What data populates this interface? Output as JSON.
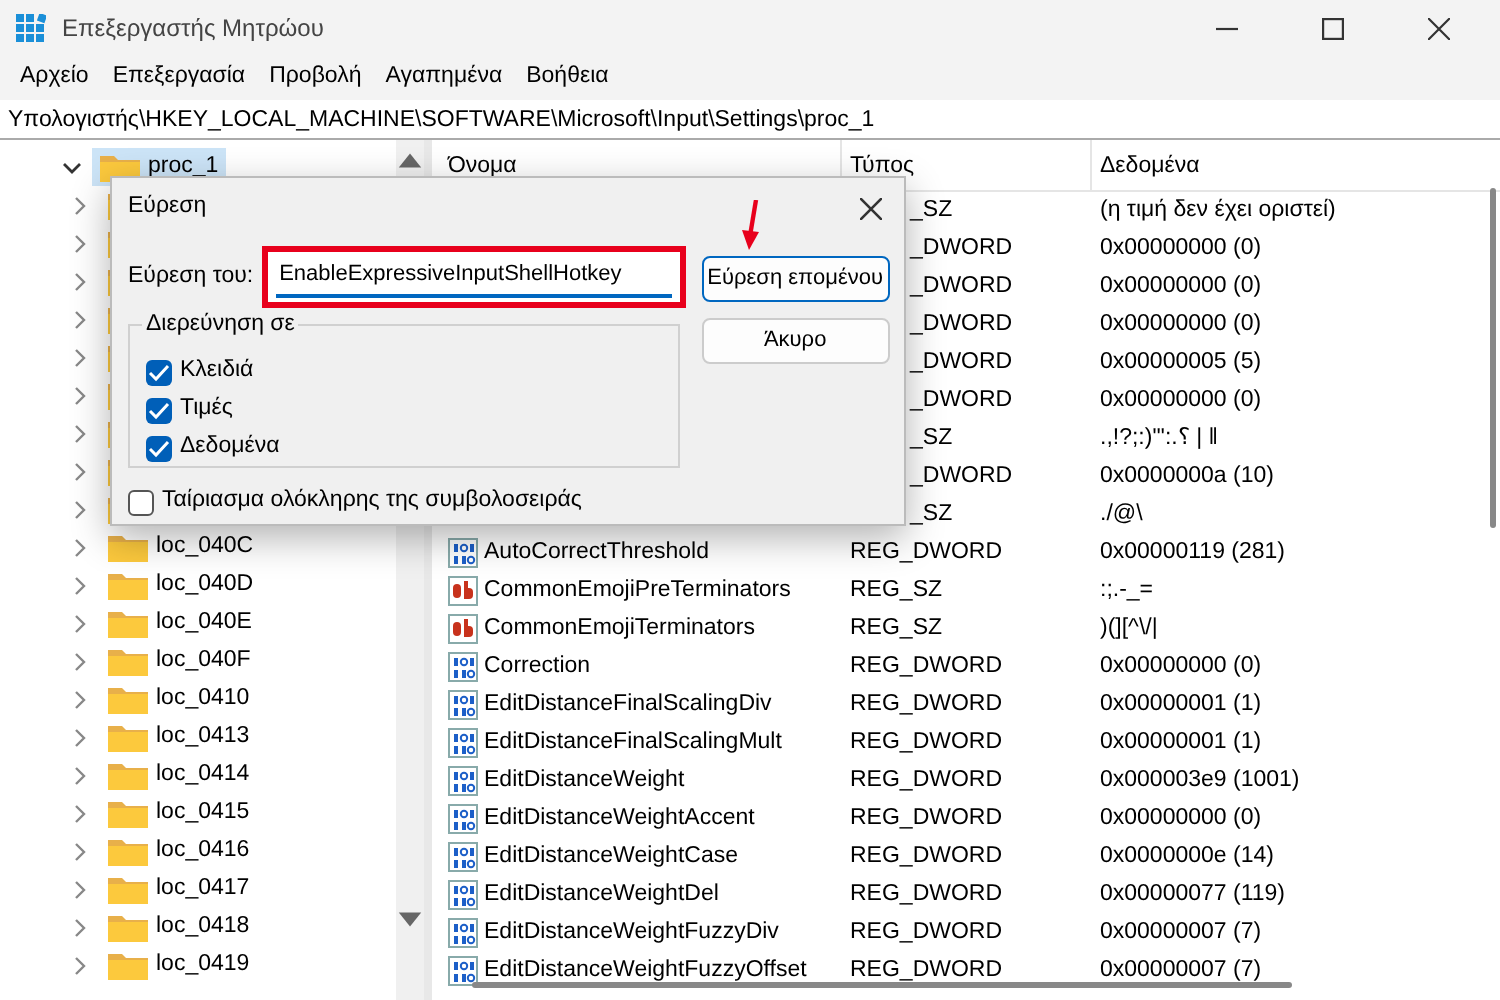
{
  "window": {
    "title": "Επεξεργαστής Μητρώου"
  },
  "menu": [
    "Αρχείο",
    "Επεξεργασία",
    "Προβολή",
    "Αγαπημένα",
    "Βοήθεια"
  ],
  "address": "Υπολογιστής\\HKEY_LOCAL_MACHINE\\SOFTWARE\\Microsoft\\Input\\Settings\\proc_1",
  "tree": {
    "label": "proc_1",
    "expanded": true,
    "selected": true,
    "children": [
      {
        "expanded": false
      },
      {
        "expanded": false
      },
      {
        "expanded": false
      },
      {
        "expanded": false
      },
      {
        "expanded": false
      },
      {
        "expanded": false
      },
      {
        "expanded": false
      },
      {
        "expanded": false
      },
      {
        "expanded": false
      },
      {
        "label": "loc_040C",
        "expanded": false
      },
      {
        "label": "loc_040D",
        "expanded": false
      },
      {
        "label": "loc_040E",
        "expanded": false
      },
      {
        "label": "loc_040F",
        "expanded": false
      },
      {
        "label": "loc_0410",
        "expanded": false
      },
      {
        "label": "loc_0413",
        "expanded": false
      },
      {
        "label": "loc_0414",
        "expanded": false
      },
      {
        "label": "loc_0415",
        "expanded": false
      },
      {
        "label": "loc_0416",
        "expanded": false
      },
      {
        "label": "loc_0417",
        "expanded": false
      },
      {
        "label": "loc_0418",
        "expanded": false
      },
      {
        "label": "loc_0419",
        "expanded": false
      }
    ]
  },
  "table": {
    "columns": [
      "Όνομα",
      "Τύπος",
      "Δεδομένα"
    ],
    "rows": [
      {
        "kind": "covered",
        "type": "_SZ",
        "data": "(η τιμή δεν έχει οριστεί)"
      },
      {
        "kind": "covered",
        "type": "_DWORD",
        "data": "0x00000000 (0)"
      },
      {
        "kind": "covered",
        "type": "_DWORD",
        "data": "0x00000000 (0)"
      },
      {
        "kind": "covered",
        "type": "_DWORD",
        "data": "0x00000000 (0)"
      },
      {
        "kind": "covered",
        "type": "_DWORD",
        "data": "0x00000005 (5)"
      },
      {
        "kind": "covered",
        "type": "_DWORD",
        "data": "0x00000000 (0)"
      },
      {
        "kind": "covered",
        "type": "_SZ",
        "data": ".,!?;:)\"':.؟ | ǁ"
      },
      {
        "kind": "covered",
        "type": "_DWORD",
        "data": "0x0000000a (10)"
      },
      {
        "kind": "covered",
        "type": "_SZ",
        "data": "./@\\"
      },
      {
        "kind": "binary",
        "name": "AutoCorrectThreshold",
        "type": "REG_DWORD",
        "data": "0x00000119 (281)"
      },
      {
        "kind": "string",
        "name": "CommonEmojiPreTerminators",
        "type": "REG_SZ",
        "data": ":;.-_="
      },
      {
        "kind": "string",
        "name": "CommonEmojiTerminators",
        "type": "REG_SZ",
        "data": ")(][^\\/|"
      },
      {
        "kind": "binary",
        "name": "Correction",
        "type": "REG_DWORD",
        "data": "0x00000000 (0)"
      },
      {
        "kind": "binary",
        "name": "EditDistanceFinalScalingDiv",
        "type": "REG_DWORD",
        "data": "0x00000001 (1)"
      },
      {
        "kind": "binary",
        "name": "EditDistanceFinalScalingMult",
        "type": "REG_DWORD",
        "data": "0x00000001 (1)"
      },
      {
        "kind": "binary",
        "name": "EditDistanceWeight",
        "type": "REG_DWORD",
        "data": "0x000003e9 (1001)"
      },
      {
        "kind": "binary",
        "name": "EditDistanceWeightAccent",
        "type": "REG_DWORD",
        "data": "0x00000000 (0)"
      },
      {
        "kind": "binary",
        "name": "EditDistanceWeightCase",
        "type": "REG_DWORD",
        "data": "0x0000000e (14)"
      },
      {
        "kind": "binary",
        "name": "EditDistanceWeightDel",
        "type": "REG_DWORD",
        "data": "0x00000077 (119)"
      },
      {
        "kind": "binary",
        "name": "EditDistanceWeightFuzzyDiv",
        "type": "REG_DWORD",
        "data": "0x00000007 (7)"
      },
      {
        "kind": "binary",
        "name": "EditDistanceWeightFuzzyOffset",
        "type": "REG_DWORD",
        "data": "0x00000007 (7)"
      }
    ]
  },
  "dialog": {
    "title": "Εύρεση",
    "find_label": "Εύρεση του:",
    "find_value": "EnableExpressiveInputShellHotkey",
    "buttons": [
      {
        "label": "Εύρεση επομένου",
        "default": true
      },
      {
        "label": "Άκυρο",
        "default": false
      }
    ],
    "group": "Διερεύνηση σε",
    "options": [
      {
        "label": "Κλειδιά",
        "checked": true
      },
      {
        "label": "Τιμές",
        "checked": true
      },
      {
        "label": "Δεδομένα",
        "checked": true
      }
    ],
    "match_whole": {
      "label": "Ταίριασμα ολόκληρης της συμβολοσειράς",
      "checked": false
    }
  }
}
